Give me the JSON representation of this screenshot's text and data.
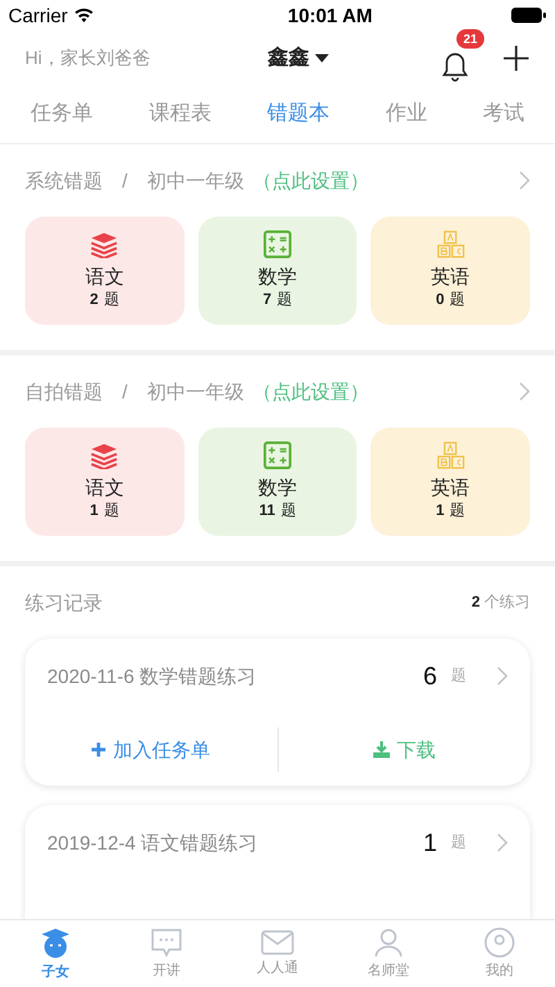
{
  "status_bar": {
    "carrier": "Carrier",
    "time": "10:01 AM"
  },
  "header": {
    "greeting": "Hi，家长刘爸爸",
    "child_name": "鑫鑫",
    "notification_count": "21"
  },
  "tabs": [
    {
      "label": "任务单",
      "selected": false
    },
    {
      "label": "课程表",
      "selected": false
    },
    {
      "label": "错题本",
      "selected": true
    },
    {
      "label": "作业",
      "selected": false
    },
    {
      "label": "考试",
      "selected": false
    }
  ],
  "sections": [
    {
      "title": "系统错题",
      "separator": "/",
      "grade": "初中一年级",
      "action": "（点此设置）",
      "subjects": [
        {
          "kind": "chinese",
          "name": "语文",
          "count": "2",
          "unit": "题"
        },
        {
          "kind": "math",
          "name": "数学",
          "count": "7",
          "unit": "题"
        },
        {
          "kind": "english",
          "name": "英语",
          "count": "0",
          "unit": "题"
        }
      ]
    },
    {
      "title": "自拍错题",
      "separator": "/",
      "grade": "初中一年级",
      "action": "（点此设置）",
      "subjects": [
        {
          "kind": "chinese",
          "name": "语文",
          "count": "1",
          "unit": "题"
        },
        {
          "kind": "math",
          "name": "数学",
          "count": "11",
          "unit": "题"
        },
        {
          "kind": "english",
          "name": "英语",
          "count": "1",
          "unit": "题"
        }
      ]
    }
  ],
  "practice": {
    "title": "练习记录",
    "count": "2",
    "count_unit": "个练习",
    "records": [
      {
        "title": "2020-11-6 数学错题练习",
        "count": "6",
        "unit": "题",
        "actions": [
          {
            "kind": "add",
            "label": "加入任务单"
          },
          {
            "kind": "download",
            "label": "下载"
          }
        ]
      },
      {
        "title": "2019-12-4 语文错题练习",
        "count": "1",
        "unit": "题"
      }
    ]
  },
  "tab_bar": [
    {
      "kind": "child",
      "label": "子女",
      "selected": true
    },
    {
      "kind": "chat",
      "label": "开讲",
      "selected": false
    },
    {
      "kind": "mail",
      "label": "人人通",
      "selected": false
    },
    {
      "kind": "teacher",
      "label": "名师堂",
      "selected": false
    },
    {
      "kind": "me",
      "label": "我的",
      "selected": false
    }
  ]
}
